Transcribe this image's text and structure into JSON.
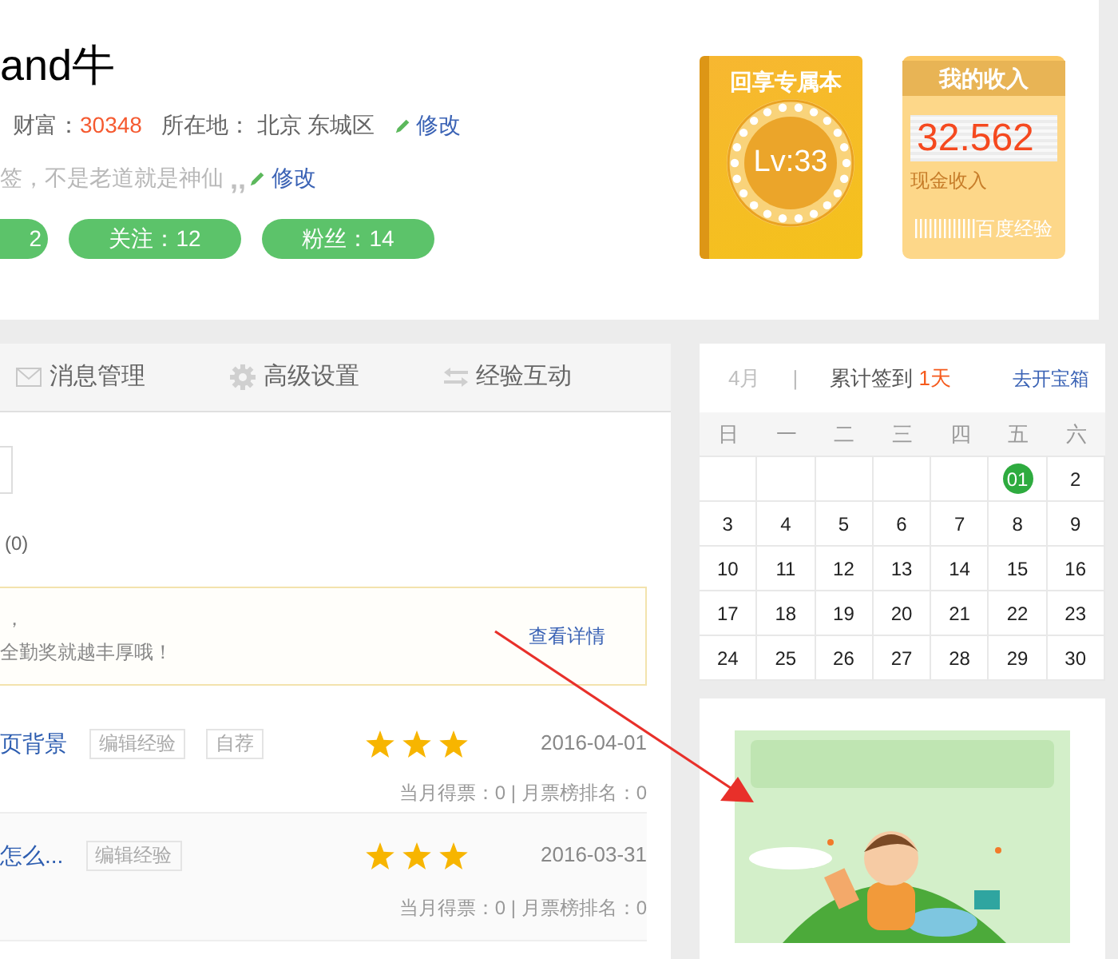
{
  "profile": {
    "name": "and牛",
    "wealth_label": "财富：",
    "wealth": "30348",
    "location_label": "所在地：",
    "location": "北京 东城区",
    "edit_link": "修改",
    "signature": "签，不是老道就是神仙",
    "signature_quote": ",,",
    "signature_edit": "修改",
    "stats": [
      "2",
      "关注：12",
      "粉丝：14"
    ]
  },
  "book_card": {
    "title": "回享专属本",
    "level": "Lv:33"
  },
  "income_card": {
    "title": "我的收入",
    "amount": "32.562",
    "caption": "现金收入",
    "brand": "百度经验"
  },
  "tabs": [
    {
      "label": "消息管理",
      "selected": false
    },
    {
      "label": "高级设置",
      "selected": false
    },
    {
      "label": "经验互动",
      "selected": false
    }
  ],
  "filter_count": "(0)",
  "notice": {
    "line_1": "，",
    "line_2": "全勤奖就越丰厚哦！",
    "link": "查看详情"
  },
  "experiences": [
    {
      "title": "页背景",
      "tags": [
        "编辑经验",
        "自荐"
      ],
      "stars": 3,
      "date": "2016-04-01",
      "votes": "当月得票：0 | 月票榜排名：0"
    },
    {
      "title": "怎么...",
      "tags": [
        "编辑经验"
      ],
      "stars": 3,
      "date": "2016-03-31",
      "votes": "当月得票：0 | 月票榜排名：0"
    }
  ],
  "calendar": {
    "month": "4月",
    "separator": "|",
    "streak_label": "累计签到",
    "streak": "1天",
    "link": "去开宝箱",
    "weekdays": [
      "日",
      "一",
      "二",
      "三",
      "四",
      "五",
      "六"
    ],
    "days": [
      {
        "label": "01",
        "signed": true
      },
      {
        "label": "2",
        "signed": false
      },
      {
        "label": "3",
        "signed": false
      },
      {
        "label": "4",
        "signed": false
      },
      {
        "label": "5",
        "signed": false
      },
      {
        "label": "6",
        "signed": false
      },
      {
        "label": "7",
        "signed": false
      },
      {
        "label": "8",
        "signed": false
      },
      {
        "label": "9",
        "signed": false
      },
      {
        "label": "10",
        "signed": false
      },
      {
        "label": "11",
        "signed": false
      },
      {
        "label": "12",
        "signed": false
      },
      {
        "label": "13",
        "signed": false
      },
      {
        "label": "14",
        "signed": false
      },
      {
        "label": "15",
        "signed": false
      },
      {
        "label": "16",
        "signed": false
      },
      {
        "label": "17",
        "signed": false
      },
      {
        "label": "18",
        "signed": false
      },
      {
        "label": "19",
        "signed": false
      },
      {
        "label": "20",
        "signed": false
      },
      {
        "label": "21",
        "signed": false
      },
      {
        "label": "22",
        "signed": false
      },
      {
        "label": "23",
        "signed": false
      },
      {
        "label": "24",
        "signed": false
      },
      {
        "label": "25",
        "signed": false
      },
      {
        "label": "26",
        "signed": false
      },
      {
        "label": "27",
        "signed": false
      },
      {
        "label": "28",
        "signed": false
      },
      {
        "label": "29",
        "signed": false
      },
      {
        "label": "30",
        "signed": false
      }
    ]
  }
}
